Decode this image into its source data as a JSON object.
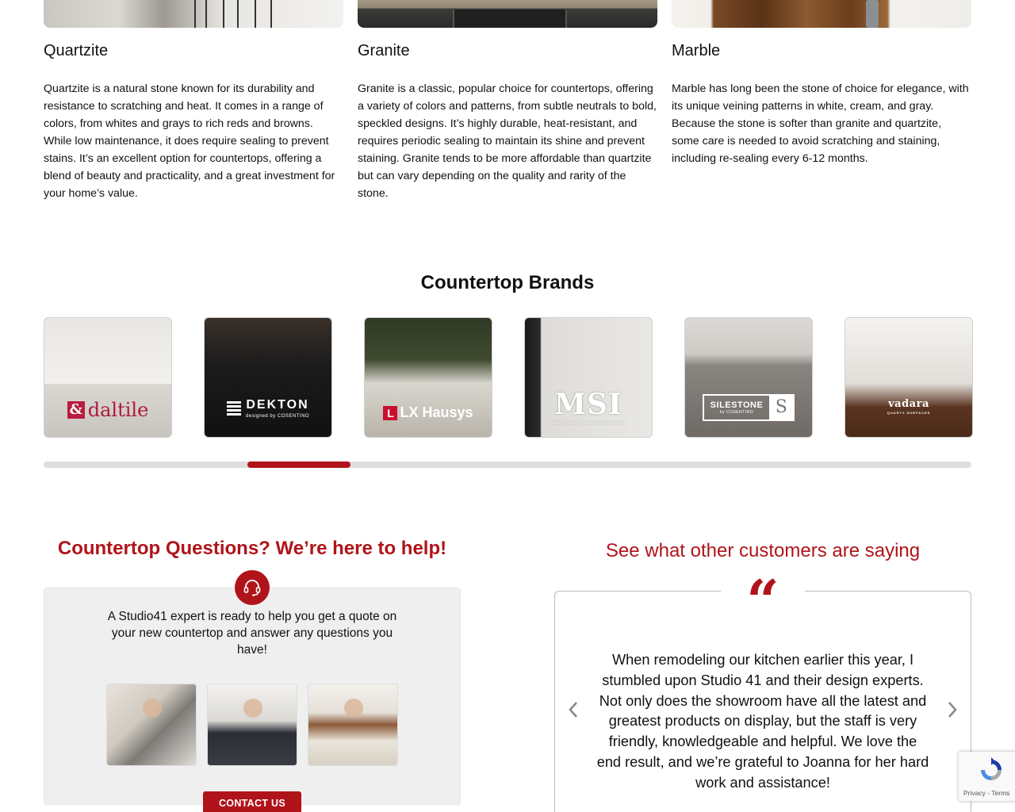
{
  "stones": [
    {
      "name": "Quartzite",
      "description": "Quartzite is a natural stone known for its durability and resistance to scratching and heat. It comes in a range of colors, from whites and grays to rich reds and browns. While low maintenance, it does require sealing to prevent stains. It’s an excellent option for countertops, offering a blend of beauty and practicality, and a great investment for your home’s value."
    },
    {
      "name": "Granite",
      "description": "Granite is a classic, popular choice for countertops, offering a variety of colors and patterns, from subtle neutrals to bold, speckled designs. It’s highly durable, heat-resistant, and requires periodic sealing to maintain its shine and prevent staining. Granite tends to be more affordable than quartzite but can vary depending on the quality and rarity of the stone."
    },
    {
      "name": "Marble",
      "description": "Marble has long been the stone of choice for elegance, with its unique veining patterns in white, cream, and gray. Because the stone is softer than granite and quartzite, some care is needed to avoid scratching and staining, including re-sealing every 6-12 months."
    }
  ],
  "brands": {
    "title": "Countertop Brands",
    "items": [
      {
        "name": "daltile",
        "logo_text": "daltile"
      },
      {
        "name": "dekton",
        "logo_text": "DEKTON",
        "sub": "designed by COSENTINO"
      },
      {
        "name": "lx-hausys",
        "logo_text": "LX Hausys",
        "mark": "L"
      },
      {
        "name": "msi",
        "logo_text": "MSI",
        "sub": "Making Luxury Surfaces Affordable"
      },
      {
        "name": "silestone",
        "logo_text": "SILESTONE",
        "sub": "by COSENTINO",
        "mark": "S"
      },
      {
        "name": "vadara",
        "logo_text": "vadara",
        "sub": "QUARTZ SURFACES"
      }
    ],
    "scroll_position": 0.22
  },
  "help": {
    "title": "Countertop Questions? We’re here to help!",
    "text": "A Studio41 expert is ready to help you get a quote on your new countertop and answer any questions you have!",
    "button_label": "CONTACT US",
    "icon": "headset-icon"
  },
  "testimonial": {
    "title": "See what other customers are saying",
    "quote_mark": "“",
    "text": "When remodeling our kitchen earlier this year, I stumbled upon Studio 41 and their design experts. Not only does the showroom have all the latest and greatest products on display, but the staff is very friendly, knowledgeable and helpful. We love the end result, and we’re grateful to Joanna for her hard work and assistance!"
  },
  "recaptcha": {
    "links": "Privacy - Terms"
  },
  "colors": {
    "accent": "#b0141a",
    "help_box_bg": "#efefef",
    "scroll_track": "#dedede"
  }
}
